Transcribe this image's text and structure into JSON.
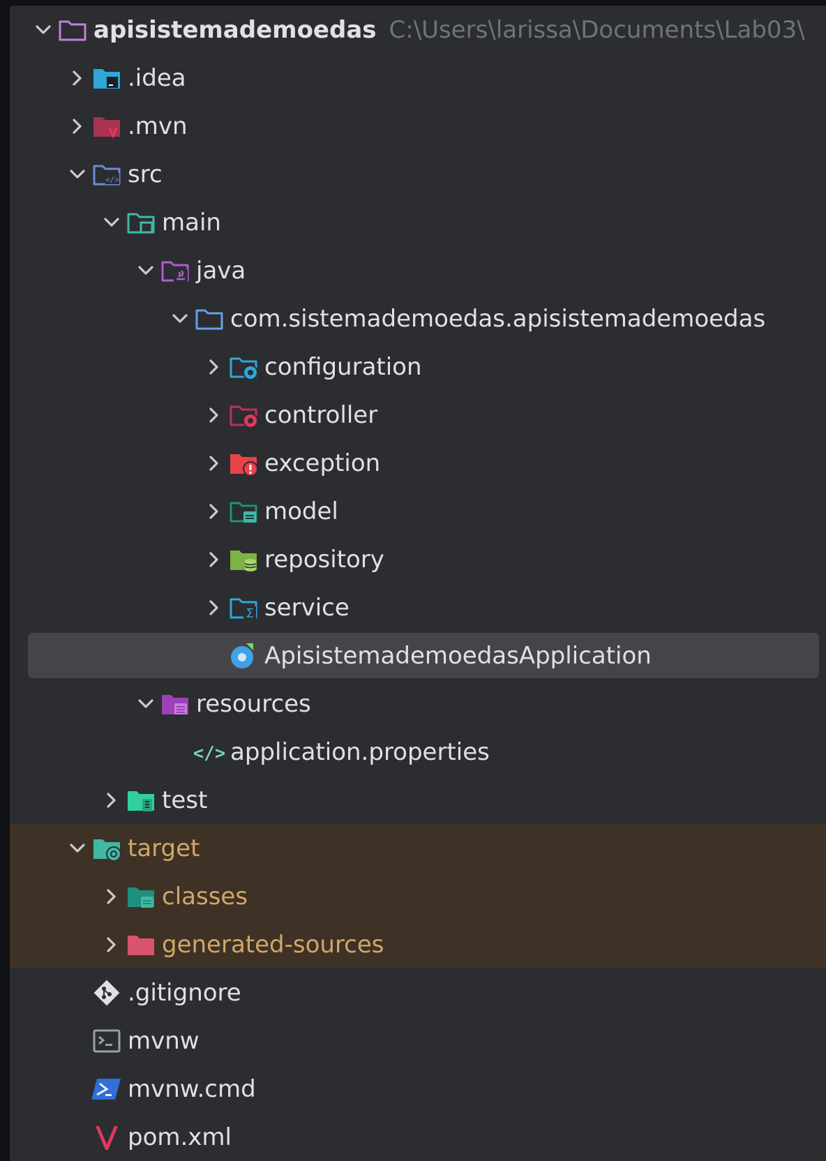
{
  "project": {
    "name": "apisistemademoedas",
    "path": "C:\\Users\\larissa\\Documents\\Lab03\\"
  },
  "colors": {
    "panel_background": "#2b2d30",
    "excluded_background": "#3e3226",
    "selected_background": "#43454a",
    "text": "#dfe1e5",
    "excluded_text": "#d2a56c",
    "path_text": "#6f737a"
  },
  "tree": [
    {
      "label": "apisistemademoedas",
      "depth": 0,
      "state": "expanded",
      "icon": "project-folder-icon"
    },
    {
      "label": ".idea",
      "depth": 1,
      "state": "collapsed",
      "icon": "idea-folder-icon"
    },
    {
      "label": ".mvn",
      "depth": 1,
      "state": "collapsed",
      "icon": "mvn-folder-icon"
    },
    {
      "label": "src",
      "depth": 1,
      "state": "expanded",
      "icon": "source-folder-icon"
    },
    {
      "label": "main",
      "depth": 2,
      "state": "expanded",
      "icon": "main-folder-icon"
    },
    {
      "label": "java",
      "depth": 3,
      "state": "expanded",
      "icon": "java-sources-folder-icon"
    },
    {
      "label": "com.sistemademoedas.apisistemademoedas",
      "depth": 4,
      "state": "expanded",
      "icon": "package-folder-icon"
    },
    {
      "label": "configuration",
      "depth": 5,
      "state": "collapsed",
      "icon": "configuration-folder-icon"
    },
    {
      "label": "controller",
      "depth": 5,
      "state": "collapsed",
      "icon": "controller-folder-icon"
    },
    {
      "label": "exception",
      "depth": 5,
      "state": "collapsed",
      "icon": "exception-folder-icon"
    },
    {
      "label": "model",
      "depth": 5,
      "state": "collapsed",
      "icon": "model-folder-icon"
    },
    {
      "label": "repository",
      "depth": 5,
      "state": "collapsed",
      "icon": "repository-folder-icon"
    },
    {
      "label": "service",
      "depth": 5,
      "state": "collapsed",
      "icon": "service-folder-icon"
    },
    {
      "label": "ApisistemademoedasApplication",
      "depth": 5,
      "state": "leaf",
      "icon": "spring-boot-class-icon",
      "selected": true
    },
    {
      "label": "resources",
      "depth": 3,
      "state": "expanded",
      "icon": "resources-folder-icon"
    },
    {
      "label": "application.properties",
      "depth": 4,
      "state": "leaf",
      "icon": "properties-file-icon"
    },
    {
      "label": "test",
      "depth": 2,
      "state": "collapsed",
      "icon": "test-folder-icon"
    },
    {
      "label": "target",
      "depth": 1,
      "state": "expanded",
      "icon": "target-folder-icon",
      "excluded": true
    },
    {
      "label": "classes",
      "depth": 2,
      "state": "collapsed",
      "icon": "classes-folder-icon",
      "excluded": true
    },
    {
      "label": "generated-sources",
      "depth": 2,
      "state": "collapsed",
      "icon": "generated-sources-folder-icon",
      "excluded": true
    },
    {
      "label": ".gitignore",
      "depth": 1,
      "state": "leaf",
      "icon": "gitignore-file-icon"
    },
    {
      "label": "mvnw",
      "depth": 1,
      "state": "leaf",
      "icon": "terminal-script-icon"
    },
    {
      "label": "mvnw.cmd",
      "depth": 1,
      "state": "leaf",
      "icon": "powershell-script-icon"
    },
    {
      "label": "pom.xml",
      "depth": 1,
      "state": "leaf",
      "icon": "maven-pom-icon"
    }
  ]
}
